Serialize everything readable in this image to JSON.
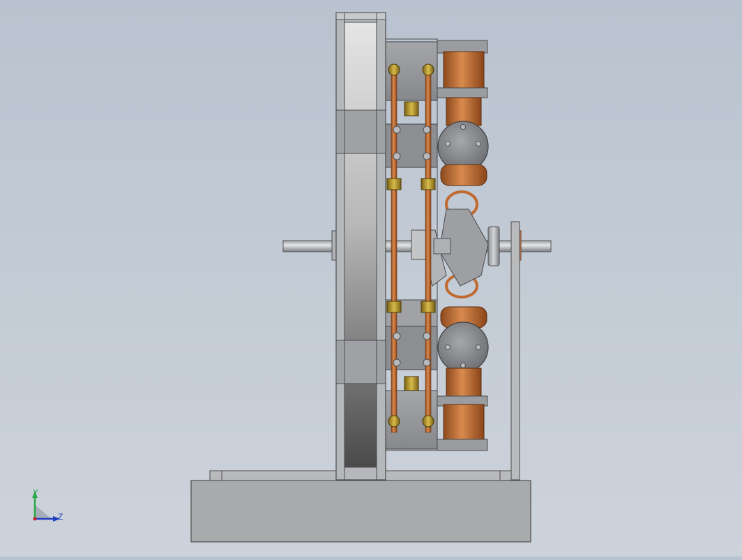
{
  "viewport": {
    "background_top": "#b9c3cf",
    "background_bottom": "#cdd3db"
  },
  "triad": {
    "y_label": "Y",
    "z_label": "Z",
    "y_color": "#2aa84a",
    "z_color": "#1f3fbf",
    "origin_color": "#c8202a"
  },
  "colors": {
    "steel_light": "#cfd0d2",
    "steel_mid": "#a8aaad",
    "steel_dark": "#6d7074",
    "copper": "#b9672f",
    "copper_light": "#d98a4e",
    "brass": "#b99a2e",
    "base": "#a7a8aa"
  }
}
